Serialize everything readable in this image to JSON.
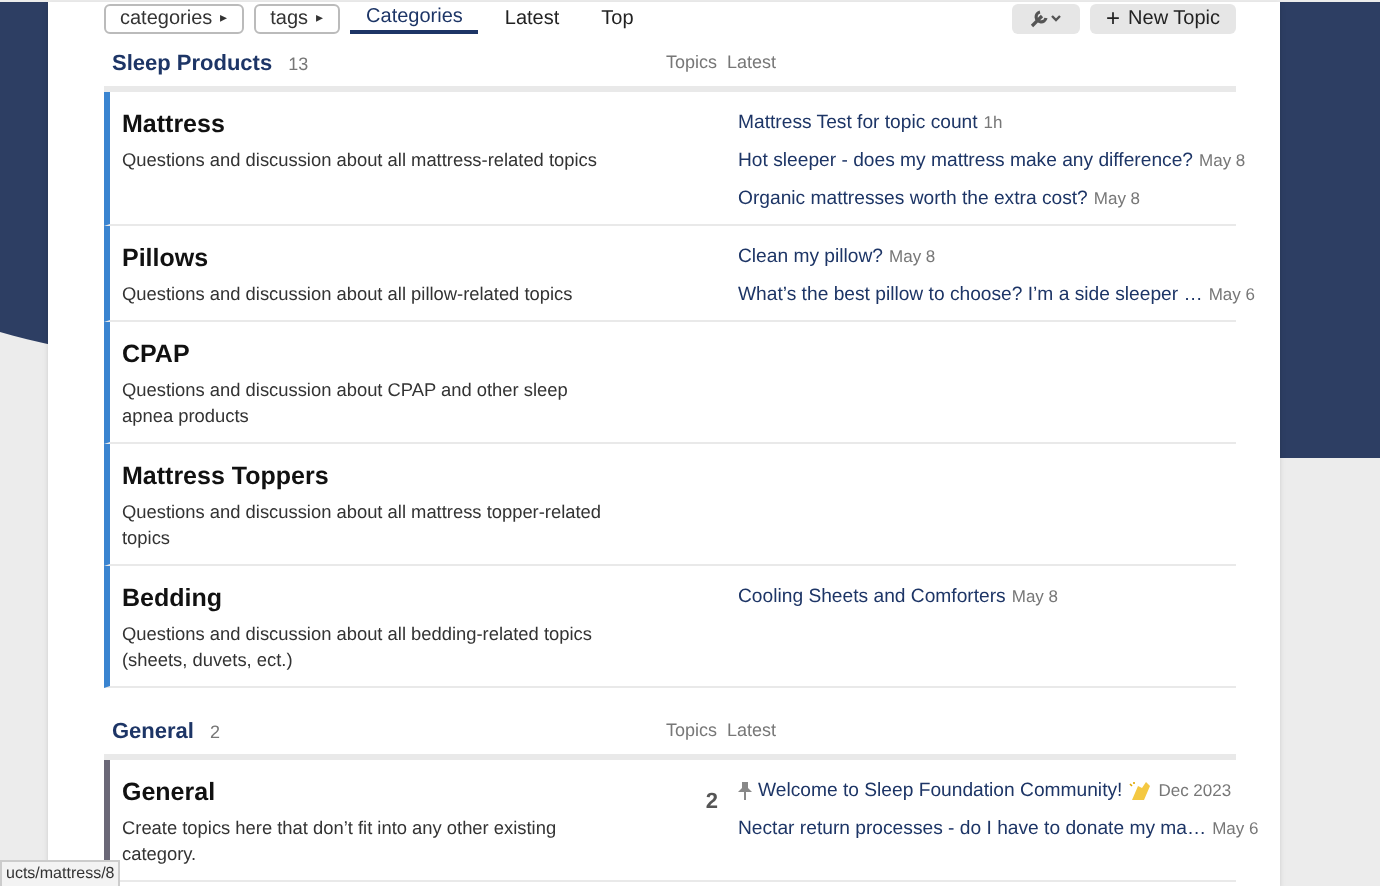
{
  "nav": {
    "buttons": [
      {
        "label": "categories",
        "caret": "▸"
      },
      {
        "label": "tags",
        "caret": "▸"
      }
    ],
    "tabs": [
      {
        "label": "Categories",
        "selected": true
      },
      {
        "label": "Latest",
        "selected": false
      },
      {
        "label": "Top",
        "selected": false
      }
    ],
    "new_topic": {
      "icon": "+",
      "label": "New Topic"
    }
  },
  "sections": [
    {
      "title": "Sleep Products",
      "count": "13",
      "columns": [
        "Topics",
        "Latest"
      ],
      "categories": [
        {
          "name": "Mattress",
          "description": "Questions and discussion about all mattress-related topics",
          "color": "#3a84d0",
          "topics": [
            {
              "kind": "normal",
              "title": "Mattress Test for topic count",
              "date": "1h"
            },
            {
              "kind": "normal",
              "title": "Hot sleeper - does my mattress make any difference?",
              "date": "May 8"
            },
            {
              "kind": "normal",
              "title": "Organic mattresses worth the extra cost?",
              "date": "May 8"
            }
          ]
        },
        {
          "name": "Pillows",
          "description": "Questions and discussion about all pillow-related topics",
          "color": "#3a84d0",
          "topics": [
            {
              "kind": "normal",
              "title": "Clean my pillow?",
              "date": "May 8"
            },
            {
              "kind": "truncated",
              "title": "What’s the best pillow to choose? I’m a side sleeper …",
              "date": "May 6"
            }
          ]
        },
        {
          "name": "CPAP",
          "description": "Questions and discussion about CPAP and other sleep apnea products",
          "color": "#3a84d0"
        },
        {
          "name": "Mattress Toppers",
          "description": "Questions and discussion about all mattress topper-related topics",
          "color": "#3a84d0"
        },
        {
          "name": "Bedding",
          "description": "Questions and discussion about all bedding-related topics (sheets, duvets, ect.)",
          "color": "#3a84d0",
          "topics": [
            {
              "kind": "normal",
              "title": "Cooling Sheets and Comforters",
              "date": "May 8"
            }
          ]
        }
      ]
    },
    {
      "title": "General",
      "count": "2",
      "columns": [
        "Topics",
        "Latest"
      ],
      "categories": [
        {
          "name": "General",
          "description": "Create topics here that don’t fit into any other existing category.",
          "color": "#6b6877",
          "topic_count": "2",
          "topics": [
            {
              "kind": "pinned",
              "title": "Welcome to Sleep Foundation Community!",
              "date": "Dec 2023",
              "emoji": {
                "kind": "clap"
              }
            },
            {
              "kind": "truncated",
              "title": "Nectar return processes - do I have to donate my ma…",
              "date": "May 6"
            }
          ]
        }
      ]
    }
  ],
  "status_url": "ucts/mattress/8"
}
